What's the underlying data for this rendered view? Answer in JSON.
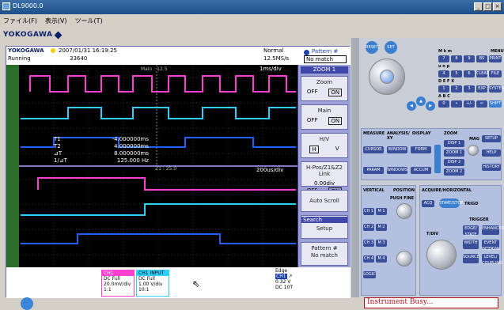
{
  "window": {
    "title": "DL9000.0"
  },
  "menu": [
    "ファイル(F)",
    "表示(V)",
    "ツール(T)"
  ],
  "brand": "YOKOGAWA",
  "scope": {
    "logo": "YOKOGAWA",
    "datetime": "2007/01/31 16:19:25",
    "state": "Running",
    "count": "33640",
    "mode": "Normal",
    "rate": "12.5MS/s",
    "pattern_label": "Pattern #",
    "pattern_value": "No match",
    "main_label": "Main : 12.5",
    "zoom_label": "Z1 : 25.0",
    "scale_main": "1ms/div",
    "scale_zoom": "200us/div",
    "cursor": [
      {
        "k": "T1",
        "v": "-4.000000ms"
      },
      {
        "k": "T2",
        "v": "4.000000ms"
      },
      {
        "k": "⊿T",
        "v": "8.000000ms"
      },
      {
        "k": "1/⊿T",
        "v": "125.000 Hz"
      }
    ]
  },
  "side_menu": {
    "header": "ZOOM 1",
    "zoom": {
      "title": "Zoom",
      "off": "OFF",
      "on": "ON"
    },
    "main": {
      "title": "Main",
      "off": "OFF",
      "on": "ON"
    },
    "hv": {
      "title": "H/V",
      "h": "H",
      "v": "V"
    },
    "hpos": {
      "title": "H-Pos/Z1&Z2 Link",
      "value": "0.00div",
      "off": "OFF",
      "on": "ON"
    },
    "auto_scroll": "Auto Scroll",
    "search": "Search",
    "setup": "Setup",
    "pattern": {
      "title": "Pattern #",
      "value": "No match"
    }
  },
  "footer": {
    "ch1": {
      "head": "CH1",
      "l1": "DC Full",
      "l2": "20.0mV/div",
      "l3": "1:1"
    },
    "ch1b": {
      "head": "CH1 INPUT",
      "l1": "DC Full",
      "l2": "1.00 V/div",
      "l3": "10:1"
    },
    "trig": {
      "mode": "Edge",
      "ch": "CH1",
      "level": "0.32 V",
      "coupling": "DC 10T"
    }
  },
  "panel": {
    "reset": "RESET",
    "set": "SET",
    "keys": [
      [
        "7",
        "8",
        "9",
        "BS",
        "PRINT"
      ],
      [
        "4",
        "5",
        "6",
        "CLEAR",
        "FILE"
      ],
      [
        "1",
        "2",
        "3",
        "EXP",
        "SYSTEM"
      ],
      [
        "0",
        "•",
        "+/-",
        "↵",
        "SHIFT"
      ]
    ],
    "key_letters": [
      "M k m",
      "u n p",
      "D E F X",
      "A B C"
    ],
    "menu_label": "MENU",
    "sections": {
      "measure": "MEASURE",
      "analysis": "ANALYSIS/ XY",
      "display": "DISPLAY",
      "zoom": "ZOOM",
      "mag": "MAG",
      "setup": "SETUP",
      "help": "HELP",
      "history": "HISTORY",
      "cursor": "CURSOR",
      "window": "WINDOW",
      "form": "FORM",
      "intensity": "INTENSITY",
      "disp1": "DISP 1",
      "zoom1": "ZOOM 1",
      "disp2": "DISP 2",
      "zoom2": "ZOOM 2",
      "param": "PARAM",
      "ws": "WINDOWS",
      "accum": "ACCUM",
      "vertical": "VERTICAL",
      "position": "POSITION",
      "acq_horiz": "ACQUIRE/HORIZONTAL",
      "acq": "ACQ",
      "start_stop": "START/STOP",
      "trigd": "TRIGD",
      "trigger": "TRIGGER",
      "tdiv": "T/DIV",
      "edge_state": "EDGE/ STATE",
      "enhanced": "ENHANCED",
      "width": "WIDTH",
      "event": "EVENT INTERVAL",
      "source": "SOURCE",
      "level": "LEVEL/ COUPLING",
      "logic": "LOGIC",
      "push_fine": "PUSH FINE"
    },
    "ch": [
      {
        "ch": "CH 1",
        "m": "M 1"
      },
      {
        "ch": "CH 2",
        "m": "M 2"
      },
      {
        "ch": "CH 3",
        "m": "M 3"
      },
      {
        "ch": "CH 4",
        "m": "M 4"
      }
    ]
  },
  "status": {
    "busy": "Instrument Busy..."
  },
  "colors": {
    "ch1": "#ff3fd0",
    "ch2": "#2ed0ff",
    "ch3": "#2060ff",
    "screen_bg": "#000000",
    "accent": "#3a4f9a"
  }
}
